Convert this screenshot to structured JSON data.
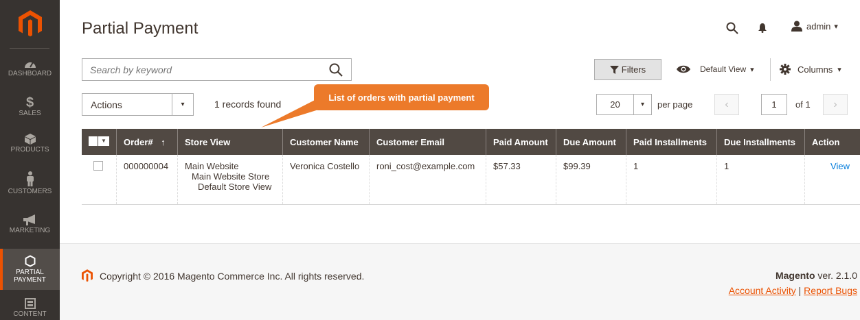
{
  "sidebar": {
    "items": [
      {
        "label": "DASHBOARD",
        "icon": "dashboard-icon"
      },
      {
        "label": "SALES",
        "icon": "dollar-icon"
      },
      {
        "label": "PRODUCTS",
        "icon": "cube-icon"
      },
      {
        "label": "CUSTOMERS",
        "icon": "person-icon"
      },
      {
        "label": "MARKETING",
        "icon": "megaphone-icon"
      },
      {
        "label": "PARTIAL PAYMENT",
        "icon": "hexagon-icon",
        "active": true
      },
      {
        "label": "CONTENT",
        "icon": "layout-icon"
      }
    ]
  },
  "header": {
    "title": "Partial Payment",
    "user": "admin",
    "user_caret": "▾"
  },
  "toolbar": {
    "search_placeholder": "Search by keyword",
    "filters_label": "Filters",
    "default_view_label": "Default View",
    "columns_label": "Columns",
    "actions_label": "Actions",
    "records_found": "1 records found",
    "per_page_value": "20",
    "per_page_label": "per page",
    "page_current": "1",
    "page_of": "of 1",
    "caret": "▾"
  },
  "callout": {
    "text": "List of orders with partial payment"
  },
  "table": {
    "headers": [
      "Order#",
      "Store View",
      "Customer Name",
      "Customer Email",
      "Paid Amount",
      "Due Amount",
      "Paid Installments",
      "Due Installments",
      "Action"
    ],
    "sort_arrow": "↑",
    "rows": [
      {
        "order": "000000004",
        "store_view_1": "Main Website",
        "store_view_2": "Main Website Store",
        "store_view_3": "Default Store View",
        "customer_name": "Veronica Costello",
        "customer_email": "roni_cost@example.com",
        "paid_amount": "$57.33",
        "due_amount": "$99.39",
        "paid_installments": "1",
        "due_installments": "1",
        "action": "View"
      }
    ]
  },
  "footer": {
    "copyright": "Copyright © 2016 Magento Commerce Inc. All rights reserved.",
    "brand": "Magento",
    "version": " ver. 2.1.0",
    "account_activity": "Account Activity",
    "separator": " | ",
    "report_bugs": "Report Bugs"
  },
  "colors": {
    "sidebar_bg": "#373330",
    "accent": "#eb5202",
    "table_header_bg": "#514943",
    "callout_bg": "#ec7a2a",
    "link": "#007bdb"
  }
}
